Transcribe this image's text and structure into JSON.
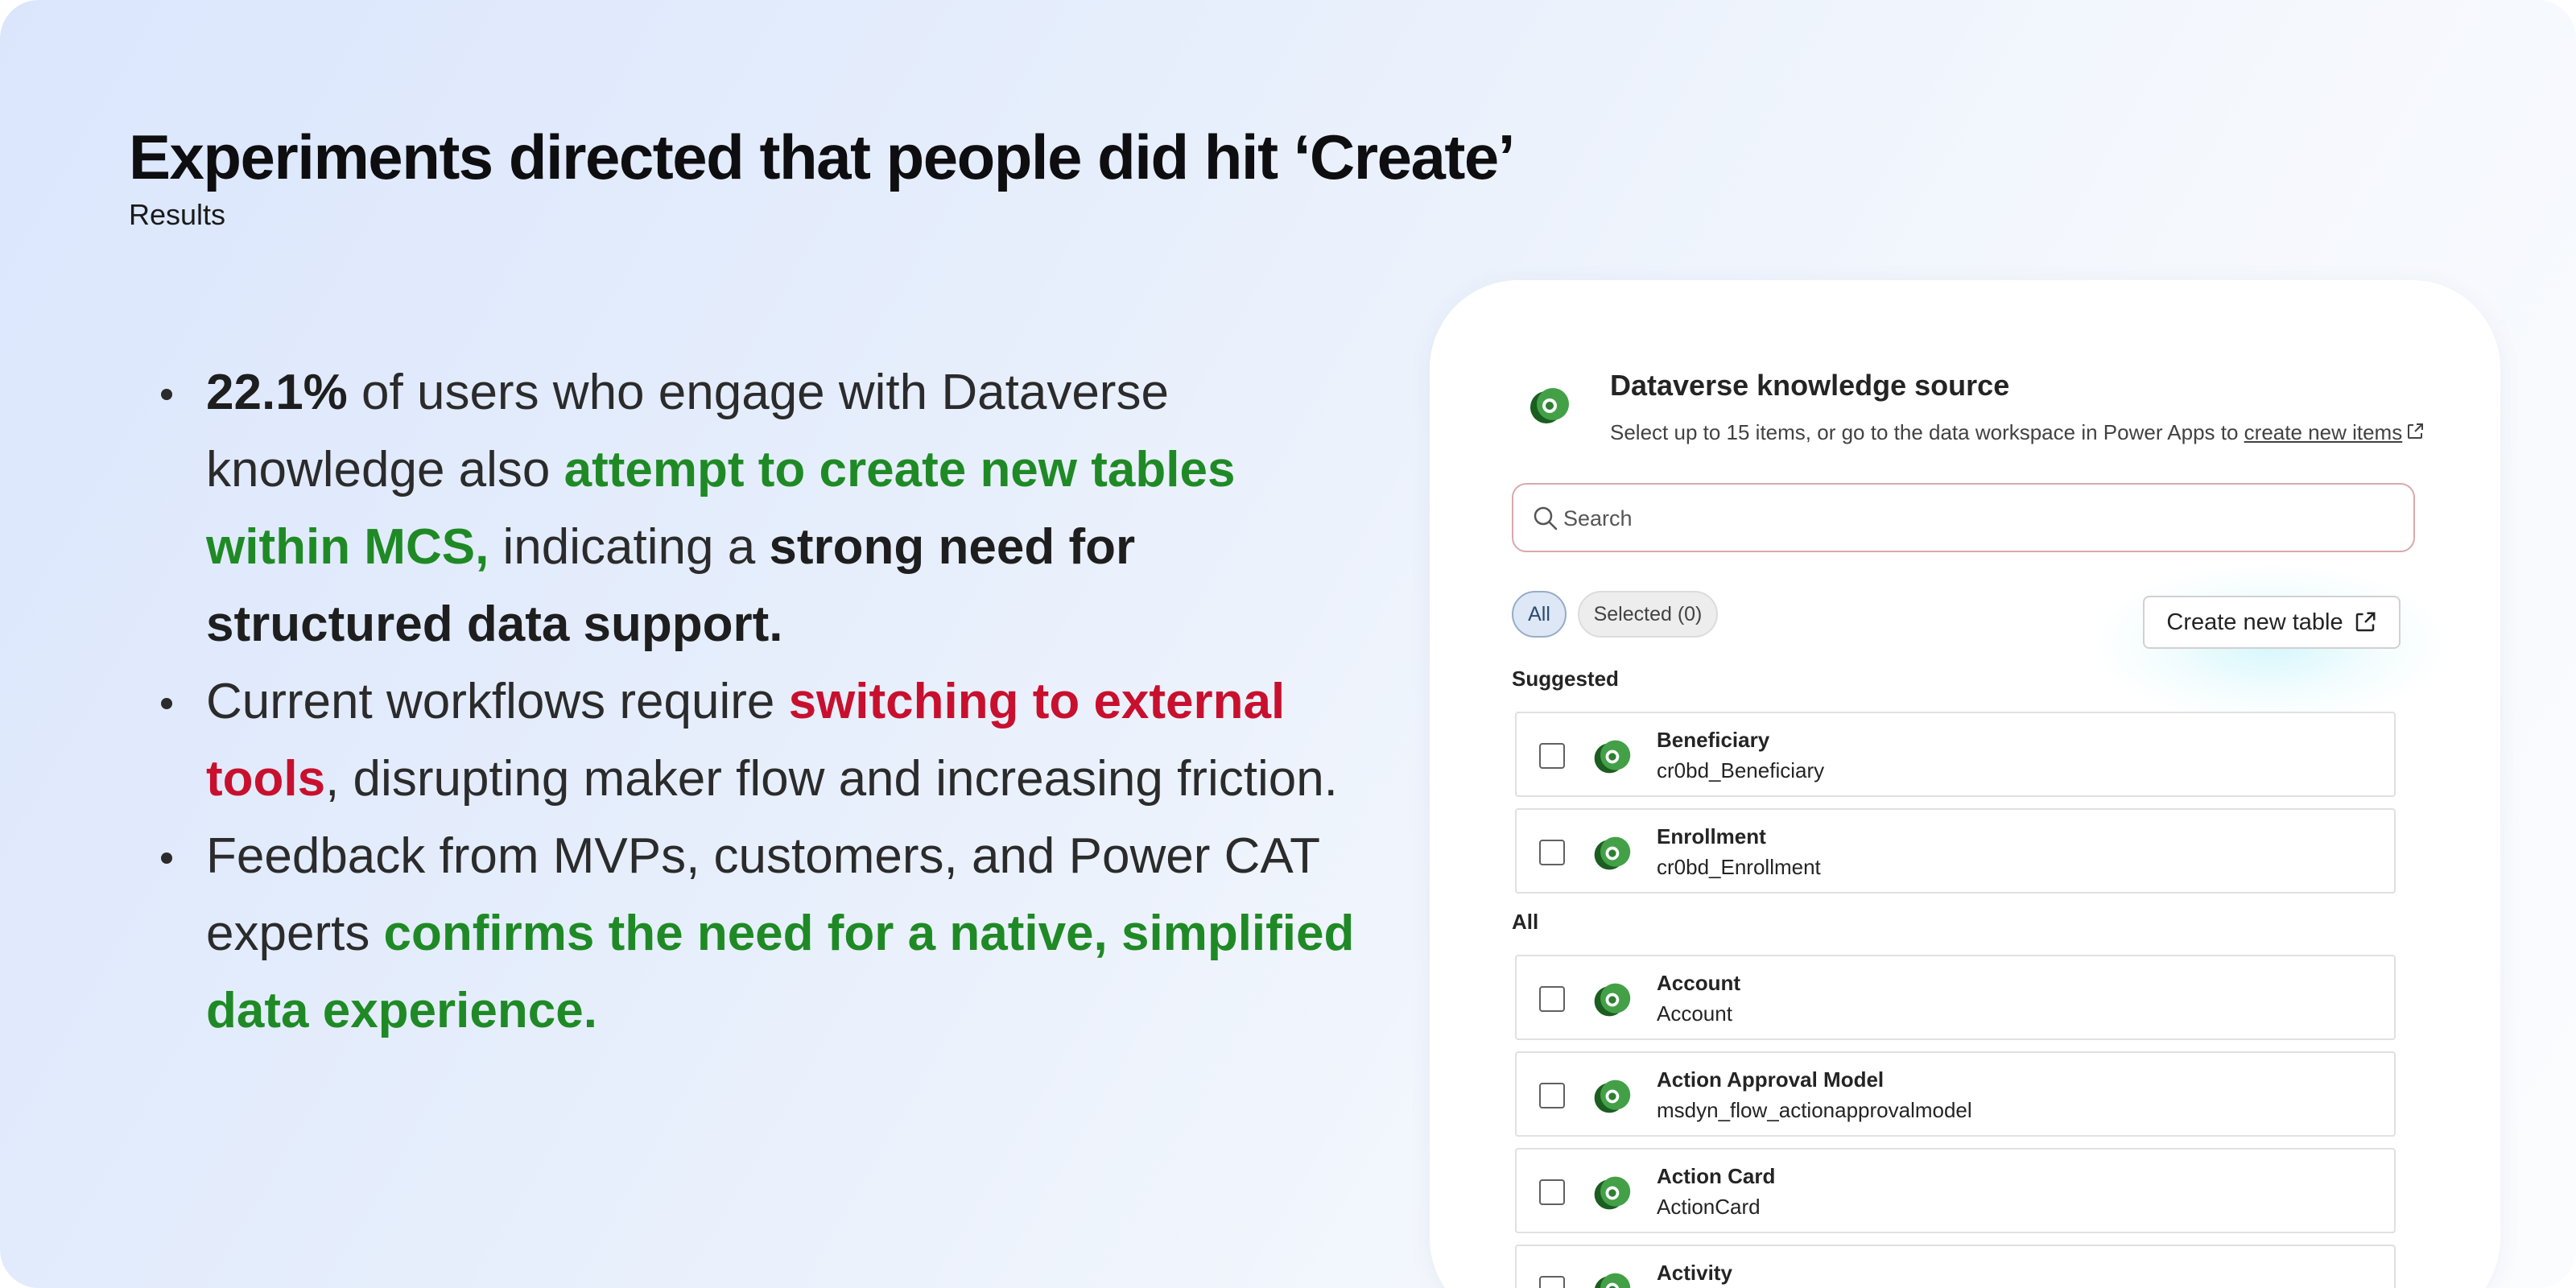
{
  "slide": {
    "title": "Experiments directed that people did hit ‘Create’",
    "subtitle": "Results"
  },
  "bullets": [
    {
      "parts": [
        {
          "text": "22.1%",
          "style": "bold"
        },
        {
          "text": " of users who engage with Dataverse knowledge also ",
          "style": "normal"
        },
        {
          "text": "attempt to create new tables within MCS,",
          "style": "green"
        },
        {
          "text": " indicating a ",
          "style": "normal"
        },
        {
          "text": "strong need for structured data support.",
          "style": "bold"
        }
      ]
    },
    {
      "parts": [
        {
          "text": "Current workflows require ",
          "style": "normal"
        },
        {
          "text": "switching to external tools",
          "style": "red"
        },
        {
          "text": ", disrupting maker flow and increasing friction.",
          "style": "normal"
        }
      ]
    },
    {
      "parts": [
        {
          "text": "Feedback from MVPs, customers, and Power CAT experts ",
          "style": "normal"
        },
        {
          "text": "confirms the need for a native, simplified data experience.",
          "style": "green"
        }
      ]
    }
  ],
  "panel": {
    "title": "Dataverse knowledge source",
    "description": "Select up to 15 items, or go to the data workspace in Power Apps to ",
    "link_text": "create new items",
    "search_placeholder": "Search",
    "filters": {
      "all_label": "All",
      "selected_label": "Selected (0)"
    },
    "create_button_label": "Create new table",
    "suggested_label": "Suggested",
    "all_section_label": "All",
    "suggested_items": [
      {
        "name": "Beneficiary",
        "logical_name": "cr0bd_Beneficiary"
      },
      {
        "name": "Enrollment",
        "logical_name": "cr0bd_Enrollment"
      }
    ],
    "all_items": [
      {
        "name": "Account",
        "logical_name": "Account"
      },
      {
        "name": "Action Approval Model",
        "logical_name": "msdyn_flow_actionapprovalmodel"
      },
      {
        "name": "Action Card",
        "logical_name": "ActionCard"
      },
      {
        "name": "Activity",
        "logical_name": ""
      }
    ]
  },
  "colors": {
    "green_emphasis": "#1f8a25",
    "red_emphasis": "#c8102e",
    "dataverse_green": "#2e7d32"
  }
}
